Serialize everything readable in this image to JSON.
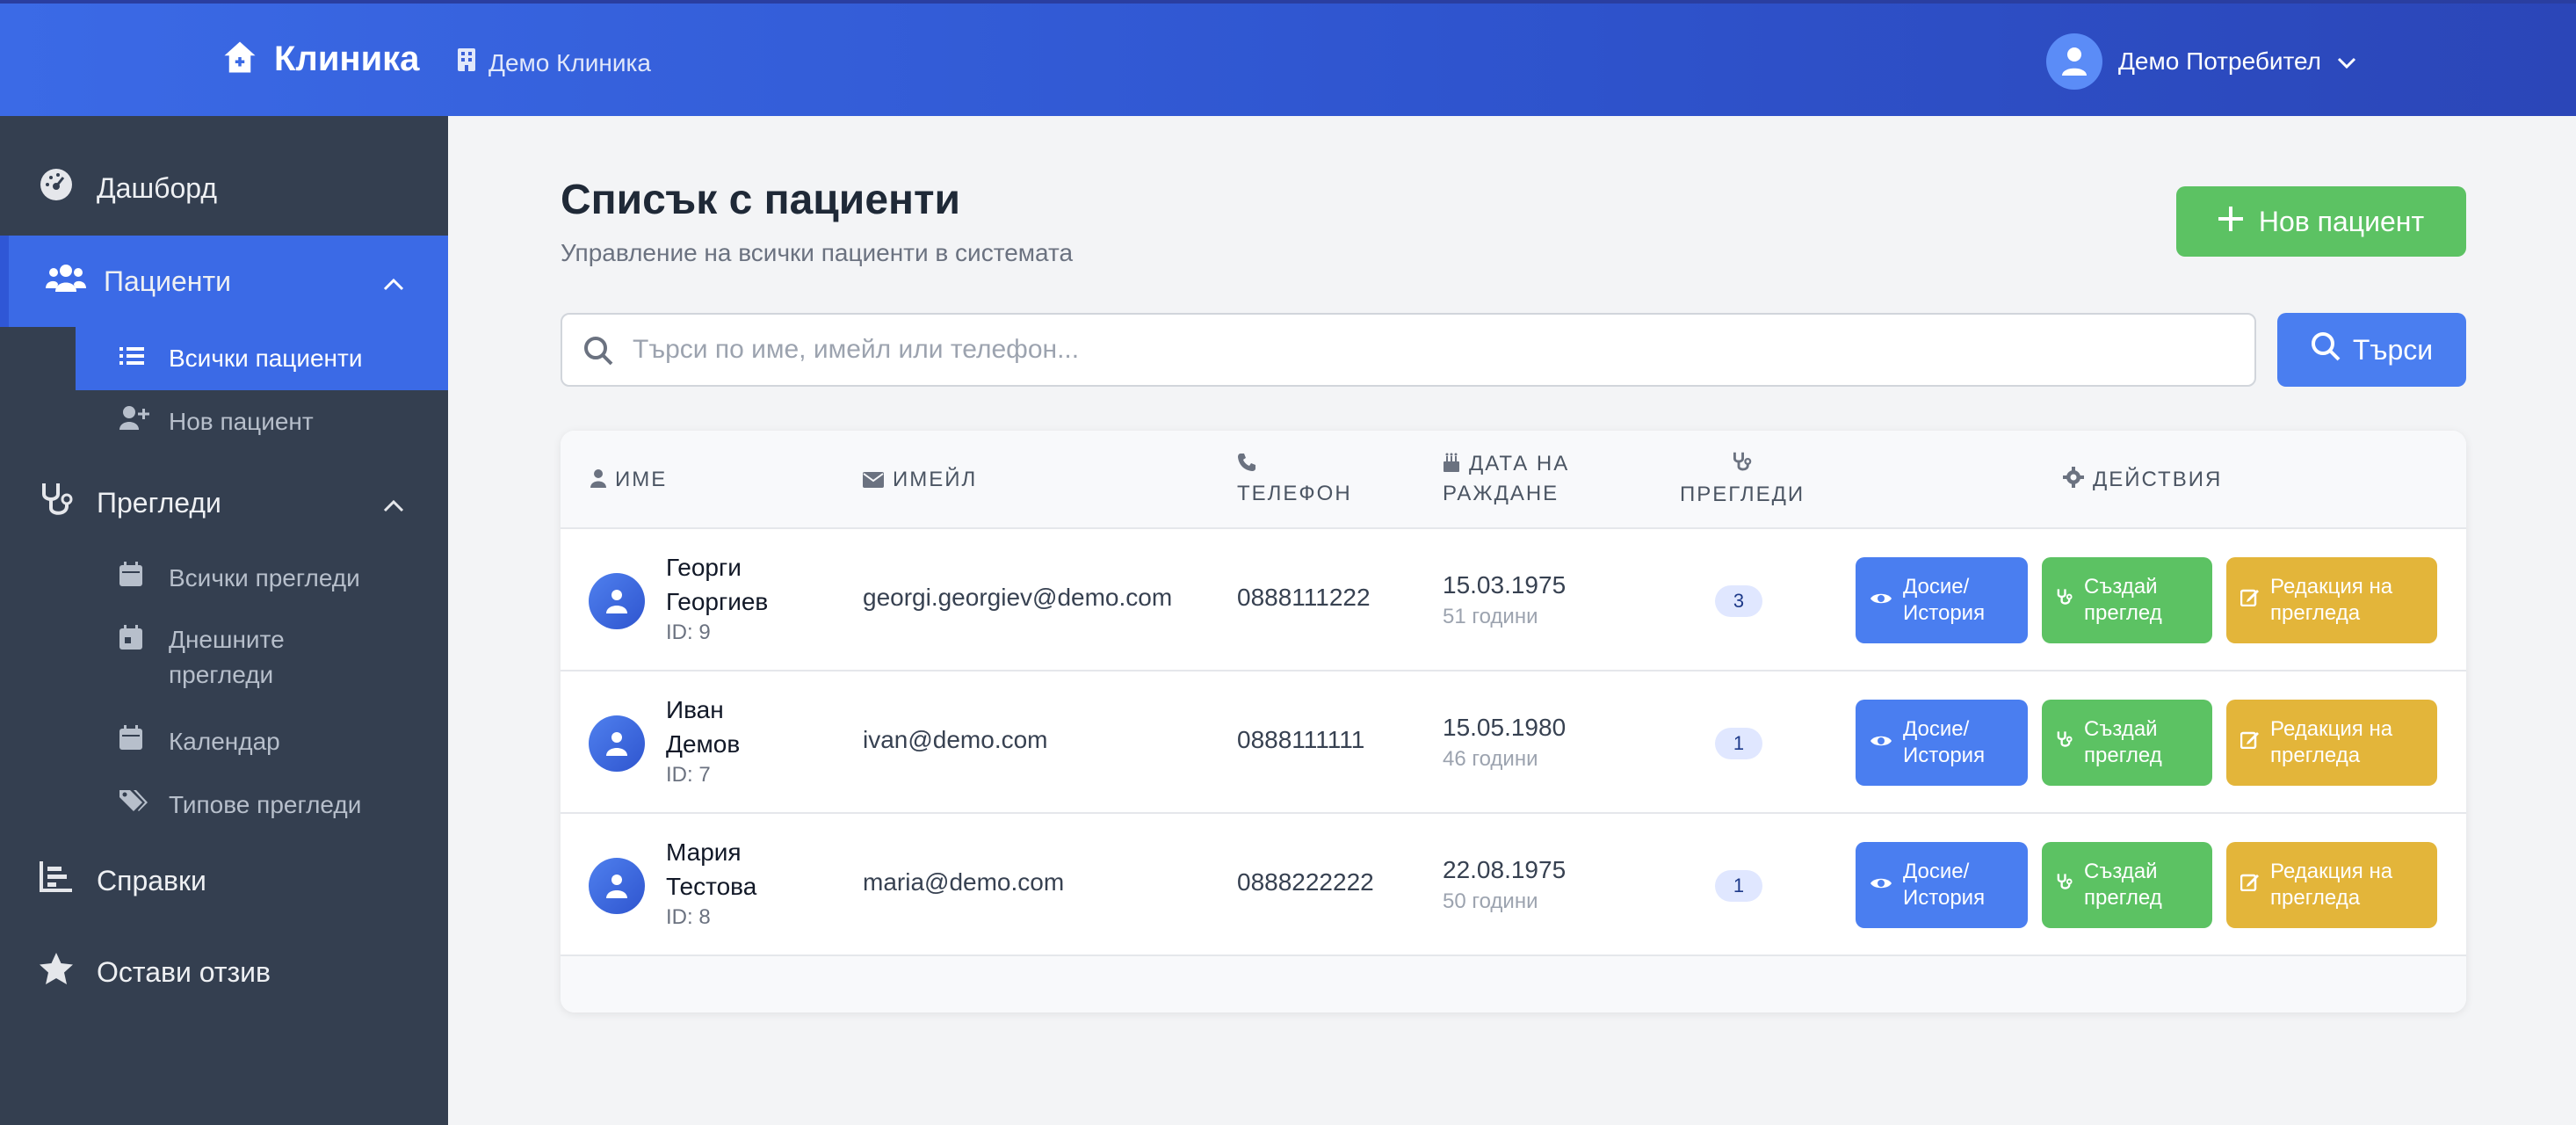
{
  "header": {
    "brand": "Клиника",
    "clinic_name": "Демо Клиника",
    "user_name": "Демо Потребител"
  },
  "sidebar": {
    "items": [
      {
        "label": "Дашборд",
        "icon": "dashboard-icon"
      },
      {
        "label": "Пациенти",
        "icon": "users-icon",
        "expanded": true,
        "active": true,
        "children": [
          {
            "label": "Всички пациенти",
            "icon": "list-icon",
            "active": true
          },
          {
            "label": "Нов пациент",
            "icon": "user-plus-icon"
          }
        ]
      },
      {
        "label": "Прегледи",
        "icon": "stethoscope-icon",
        "expanded": true,
        "children": [
          {
            "label": "Всички прегледи",
            "icon": "calendar-icon"
          },
          {
            "label": "Днешните прегледи",
            "icon": "calendar-day-icon"
          },
          {
            "label": "Календар",
            "icon": "calendar-icon"
          },
          {
            "label": "Типове прегледи",
            "icon": "tags-icon"
          }
        ]
      },
      {
        "label": "Справки",
        "icon": "chart-icon"
      },
      {
        "label": "Остави отзив",
        "icon": "star-icon"
      }
    ]
  },
  "main": {
    "title": "Списък с пациенти",
    "subtitle": "Управление на всички пациенти в системата",
    "new_patient_label": "Нов пациент",
    "search": {
      "placeholder": "Търси по име, имейл или телефон...",
      "value": "",
      "button_label": "Търси"
    },
    "table": {
      "columns": {
        "name": "ИМЕ",
        "email": "ИМЕЙЛ",
        "phone": "ТЕЛЕФОН",
        "dob_line1": "ДАТА НА",
        "dob_line2": "РАЖДАНЕ",
        "visits": "ПРЕГЛЕДИ",
        "actions": "ДЕЙСТВИЯ"
      },
      "rows": [
        {
          "name_line1": "Георги",
          "name_line2": "Георгиев",
          "id": "ID: 9",
          "email": "georgi.georgiev@demo.com",
          "phone": "0888111222",
          "dob": "15.03.1975",
          "age": "51 години",
          "visits": "3"
        },
        {
          "name_line1": "Иван",
          "name_line2": "Демов",
          "id": "ID: 7",
          "email": "ivan@demo.com",
          "phone": "0888111111",
          "dob": "15.05.1980",
          "age": "46 години",
          "visits": "1"
        },
        {
          "name_line1": "Мария",
          "name_line2": "Тестова",
          "id": "ID: 8",
          "email": "maria@demo.com",
          "phone": "0888222222",
          "dob": "22.08.1975",
          "age": "50 години",
          "visits": "1"
        }
      ],
      "actions": {
        "dossier_line1": "Досие/",
        "dossier_line2": "История",
        "create_line1": "Създай",
        "create_line2": "преглед",
        "edit_line1": "Редакция на",
        "edit_line2": "прегледа"
      }
    }
  },
  "colors": {
    "primary": "#3b6ae6",
    "success": "#5cc263",
    "warning": "#e3b53a",
    "sidebar": "#343f50"
  }
}
